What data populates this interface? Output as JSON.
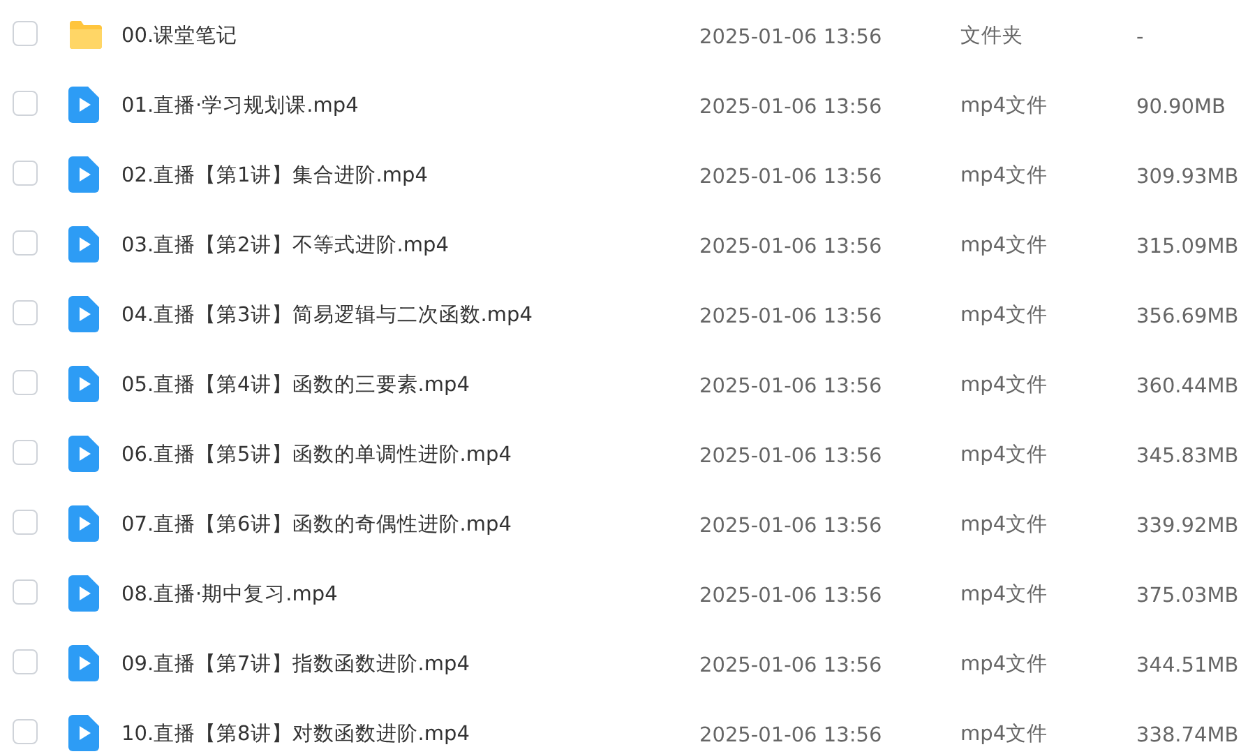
{
  "files": [
    {
      "kind": "folder",
      "checked": false,
      "name": "00.课堂笔记",
      "date": "2025-01-06 13:56",
      "type": "文件夹",
      "size": "-"
    },
    {
      "kind": "video",
      "checked": false,
      "name": "01.直播·学习规划课.mp4",
      "date": "2025-01-06 13:56",
      "type": "mp4文件",
      "size": "90.90MB"
    },
    {
      "kind": "video",
      "checked": false,
      "name": "02.直播【第1讲】集合进阶.mp4",
      "date": "2025-01-06 13:56",
      "type": "mp4文件",
      "size": "309.93MB"
    },
    {
      "kind": "video",
      "checked": false,
      "name": "03.直播【第2讲】不等式进阶.mp4",
      "date": "2025-01-06 13:56",
      "type": "mp4文件",
      "size": "315.09MB"
    },
    {
      "kind": "video",
      "checked": false,
      "name": "04.直播【第3讲】简易逻辑与二次函数.mp4",
      "date": "2025-01-06 13:56",
      "type": "mp4文件",
      "size": "356.69MB"
    },
    {
      "kind": "video",
      "checked": false,
      "name": "05.直播【第4讲】函数的三要素.mp4",
      "date": "2025-01-06 13:56",
      "type": "mp4文件",
      "size": "360.44MB"
    },
    {
      "kind": "video",
      "checked": false,
      "name": "06.直播【第5讲】函数的单调性进阶.mp4",
      "date": "2025-01-06 13:56",
      "type": "mp4文件",
      "size": "345.83MB"
    },
    {
      "kind": "video",
      "checked": false,
      "name": "07.直播【第6讲】函数的奇偶性进阶.mp4",
      "date": "2025-01-06 13:56",
      "type": "mp4文件",
      "size": "339.92MB"
    },
    {
      "kind": "video",
      "checked": false,
      "name": "08.直播·期中复习.mp4",
      "date": "2025-01-06 13:56",
      "type": "mp4文件",
      "size": "375.03MB"
    },
    {
      "kind": "video",
      "checked": false,
      "name": "09.直播【第7讲】指数函数进阶.mp4",
      "date": "2025-01-06 13:56",
      "type": "mp4文件",
      "size": "344.51MB"
    },
    {
      "kind": "video",
      "checked": false,
      "name": "10.直播【第8讲】对数函数进阶.mp4",
      "date": "2025-01-06 13:56",
      "type": "mp4文件",
      "size": "338.74MB"
    }
  ]
}
